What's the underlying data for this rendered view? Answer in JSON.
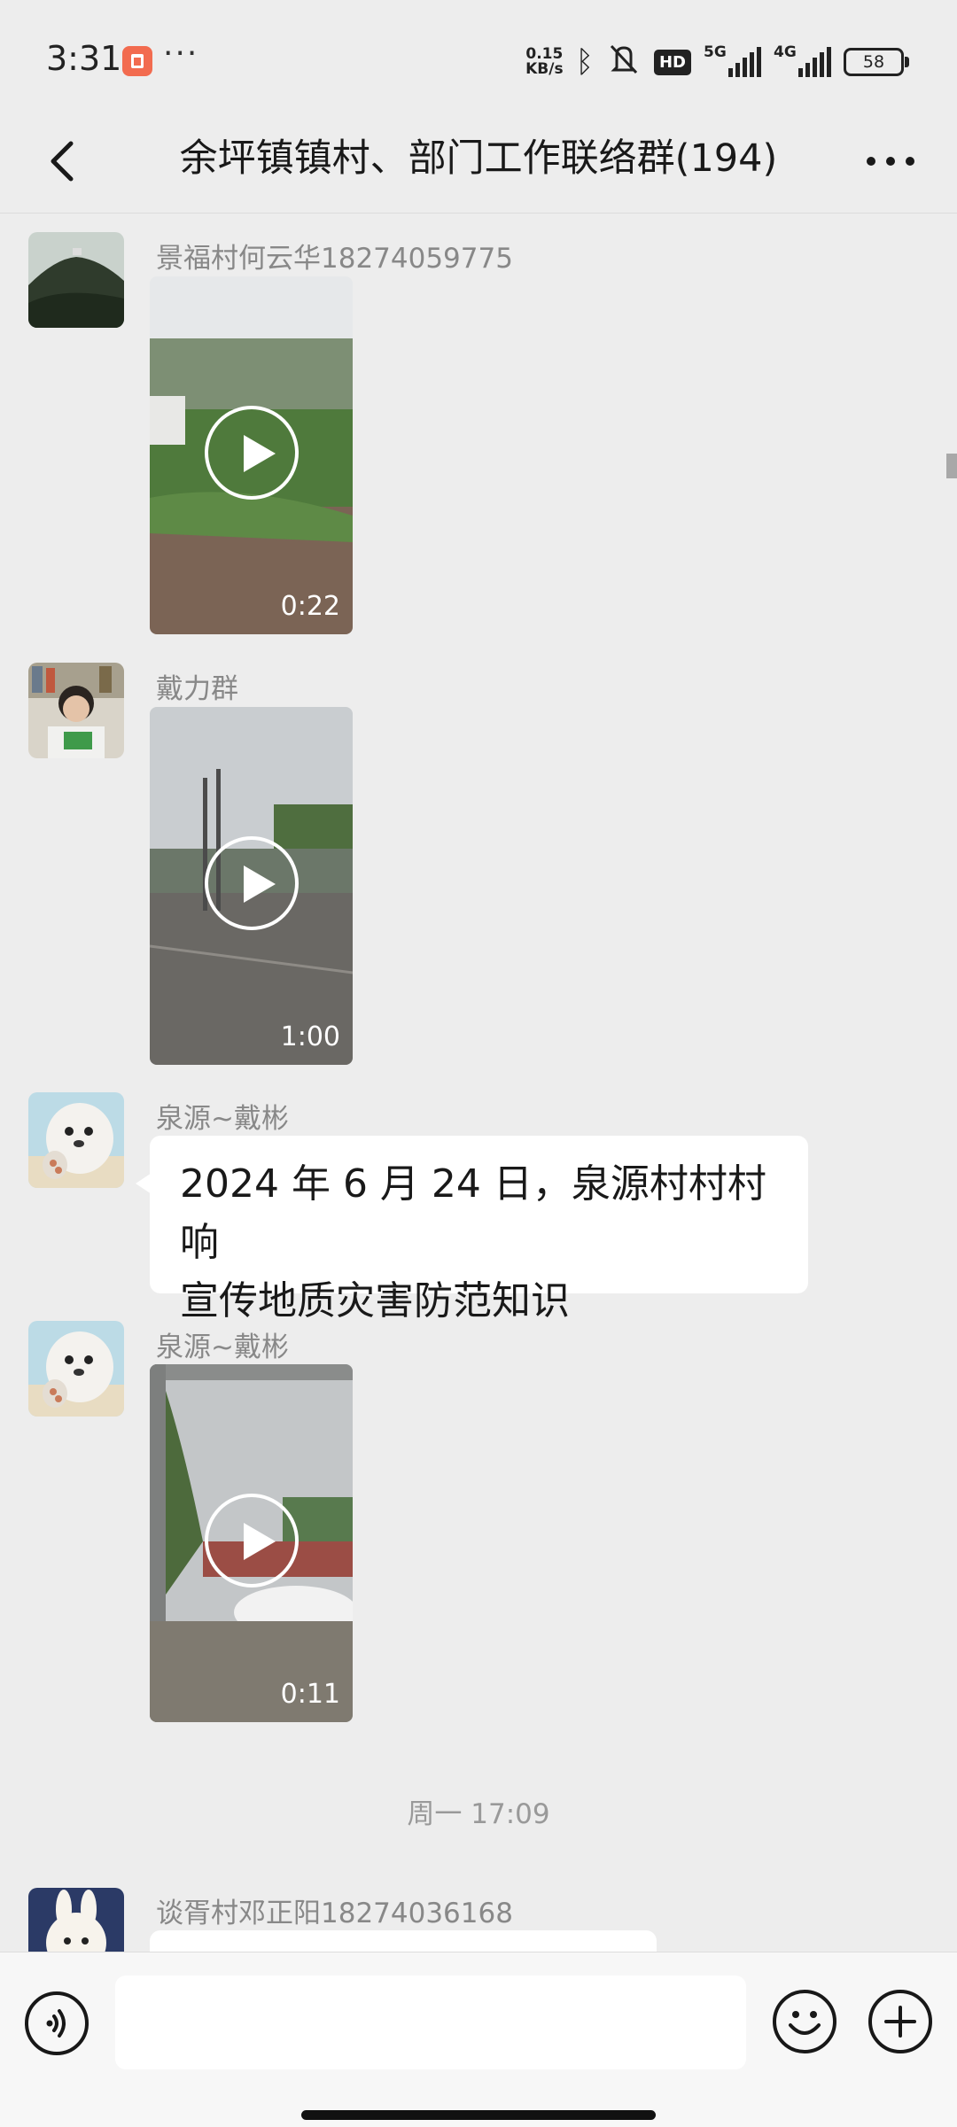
{
  "status_bar": {
    "time": "3:31",
    "more_notifications": "···",
    "net_speed_value": "0.15",
    "net_speed_unit": "KB/s",
    "hd_label": "HD",
    "signal_1_label": "5G",
    "signal_2_label": "4G",
    "battery": "58"
  },
  "header": {
    "title": "余坪镇镇村、部门工作联络群(194)"
  },
  "messages": [
    {
      "sender": "景福村何云华18274059775",
      "type": "video",
      "duration": "0:22"
    },
    {
      "sender": "戴力群",
      "type": "video",
      "duration": "1:00"
    },
    {
      "sender": "泉源~戴彬",
      "type": "text",
      "line1": "2024 年 6 月 24 日，泉源村村村响",
      "line2": "宣传地质灾害防范知识"
    },
    {
      "sender": "泉源~戴彬",
      "type": "video",
      "duration": "0:11"
    },
    {
      "sender": "谈胥村邓正阳18274036168",
      "type": "text"
    }
  ],
  "timestamp": "周一 17:09",
  "input_bar": {
    "voice_icon": "voice-icon",
    "emoji_icon": "emoji-icon",
    "plus_icon": "plus-icon"
  },
  "colors": {
    "background": "#ededed",
    "bubble": "#ffffff",
    "sender_text": "#888888"
  }
}
